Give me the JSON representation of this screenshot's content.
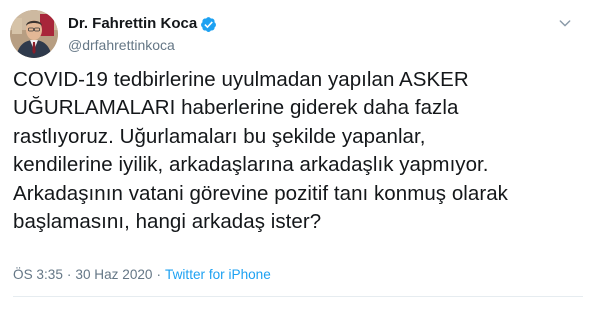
{
  "author": {
    "display_name": "Dr. Fahrettin Koca",
    "handle": "@drfahrettinkoca",
    "verified": true,
    "avatar_icon": "profile-photo"
  },
  "tweet": {
    "text": "COVID-19 tedbirlerine uyulmadan yapılan ASKER\nUĞURLAMALARI haberlerine giderek daha fazla\nrastlıyoruz. Uğurlamaları bu şekilde yapanlar,\nkendilerine iyilik, arkadaşlarına arkadaşlık yapmıyor.\nArkadaşının vatani görevine pozitif tanı konmuş olarak\nbaşlamasını, hangi arkadaş ister?"
  },
  "meta": {
    "time": "ÖS 3:35",
    "separator": "·",
    "date": "30 Haz 2020",
    "source": "Twitter for iPhone"
  },
  "colors": {
    "verified_badge": "#1da1f2",
    "source_link": "#1da1f2",
    "muted_text": "#657786"
  },
  "icons": {
    "more_menu": "chevron-down-icon",
    "verified": "verified-badge-icon"
  }
}
